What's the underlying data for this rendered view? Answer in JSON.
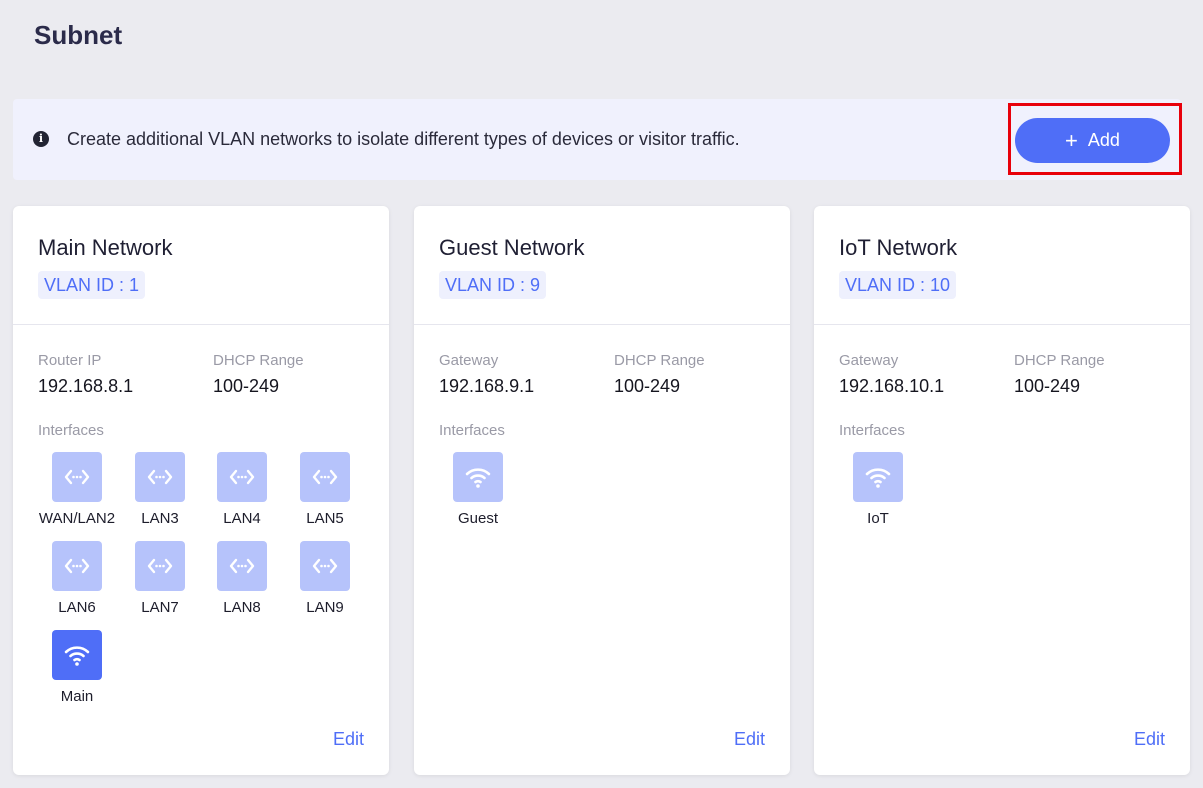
{
  "page": {
    "title": "Subnet"
  },
  "info": {
    "text": "Create additional VLAN networks to isolate different types of devices or visitor traffic.",
    "icon": "info-icon",
    "add_label": "Add"
  },
  "colors": {
    "accent": "#4f6ef7",
    "icon_inactive": "#b6c3fb",
    "highlight": "#e8000b"
  },
  "cards": [
    {
      "title": "Main Network",
      "vlan": "VLAN ID : 1",
      "ip_label": "Router IP",
      "ip": "192.168.8.1",
      "dhcp_label": "DHCP Range",
      "dhcp": "100-249",
      "interfaces_label": "Interfaces",
      "interfaces": [
        {
          "label": "WAN/LAN2",
          "icon": "ethernet-icon"
        },
        {
          "label": "LAN3",
          "icon": "ethernet-icon"
        },
        {
          "label": "LAN4",
          "icon": "ethernet-icon"
        },
        {
          "label": "LAN5",
          "icon": "ethernet-icon"
        },
        {
          "label": "LAN6",
          "icon": "ethernet-icon"
        },
        {
          "label": "LAN7",
          "icon": "ethernet-icon"
        },
        {
          "label": "LAN8",
          "icon": "ethernet-icon"
        },
        {
          "label": "LAN9",
          "icon": "ethernet-icon"
        },
        {
          "label": "Main",
          "icon": "wifi-icon"
        }
      ],
      "edit": "Edit"
    },
    {
      "title": "Guest Network",
      "vlan": "VLAN ID : 9",
      "ip_label": "Gateway",
      "ip": "192.168.9.1",
      "dhcp_label": "DHCP Range",
      "dhcp": "100-249",
      "interfaces_label": "Interfaces",
      "interfaces": [
        {
          "label": "Guest",
          "icon": "wifi-icon"
        }
      ],
      "edit": "Edit"
    },
    {
      "title": "IoT Network",
      "vlan": "VLAN ID : 10",
      "ip_label": "Gateway",
      "ip": "192.168.10.1",
      "dhcp_label": "DHCP Range",
      "dhcp": "100-249",
      "interfaces_label": "Interfaces",
      "interfaces": [
        {
          "label": "IoT",
          "icon": "wifi-icon"
        }
      ],
      "edit": "Edit"
    }
  ]
}
